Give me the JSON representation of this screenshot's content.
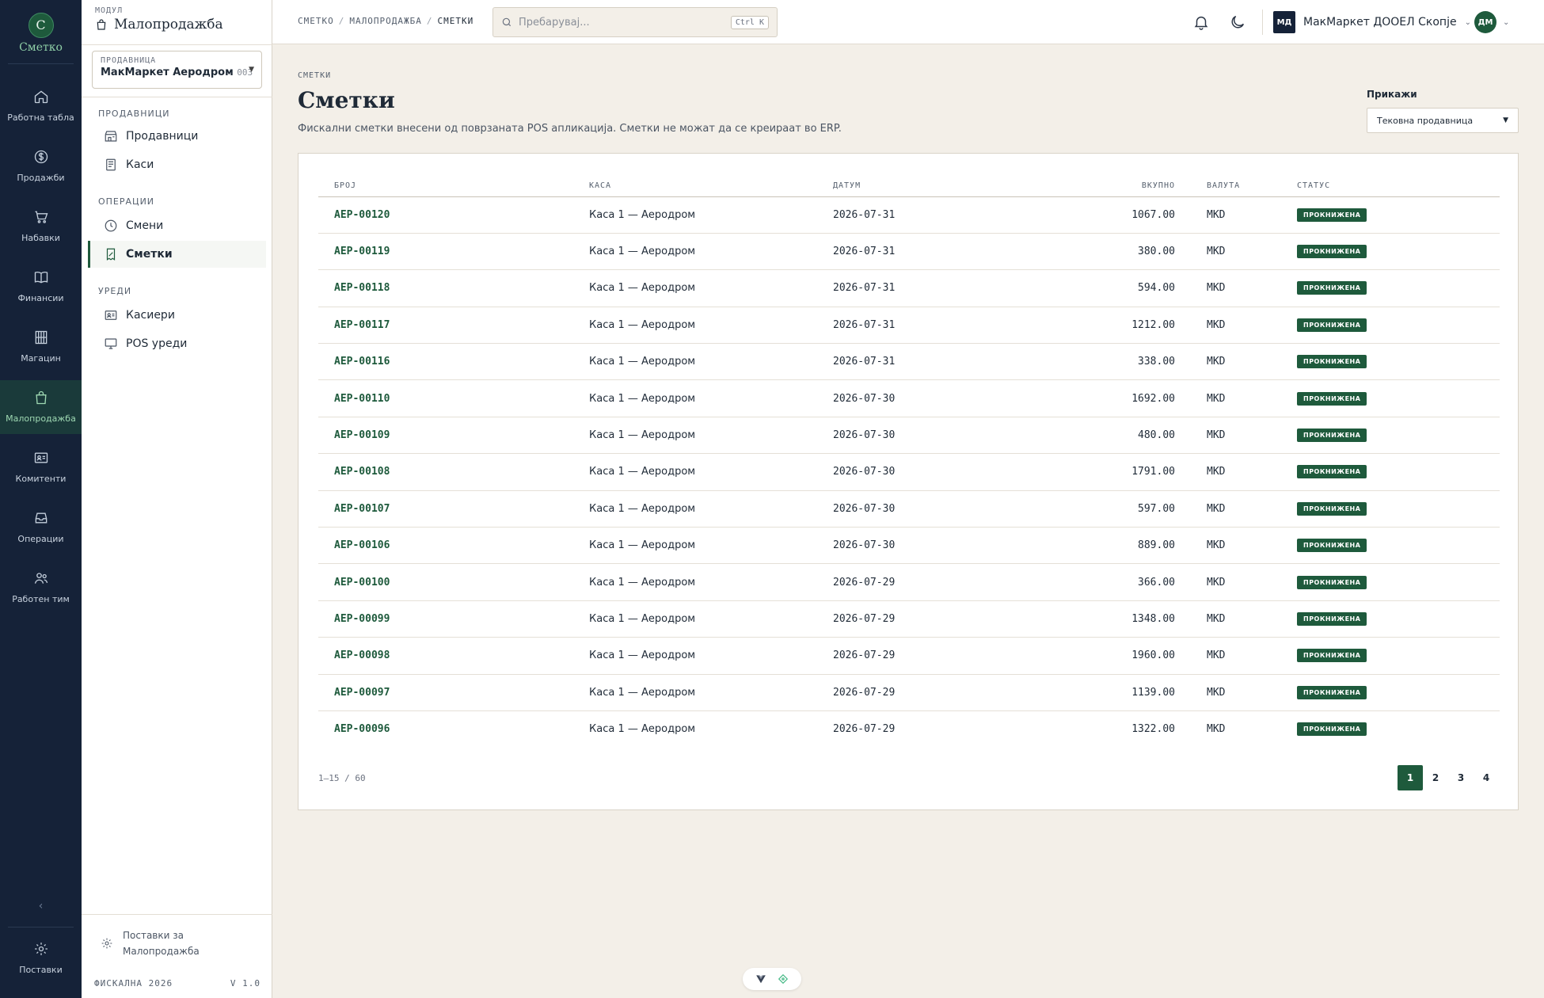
{
  "app": {
    "logo_letter": "С",
    "logo_name": "Сметко"
  },
  "rail": {
    "items": [
      {
        "label": "Работна табла",
        "icon": "home-icon"
      },
      {
        "label": "Продажби",
        "icon": "dollar-icon"
      },
      {
        "label": "Набавки",
        "icon": "cart-icon"
      },
      {
        "label": "Финансии",
        "icon": "book-icon"
      },
      {
        "label": "Магацин",
        "icon": "warehouse-icon"
      },
      {
        "label": "Малопродажба",
        "icon": "shopping-bag-icon",
        "active": true
      },
      {
        "label": "Комитенти",
        "icon": "id-card-icon"
      },
      {
        "label": "Операции",
        "icon": "inbox-icon"
      },
      {
        "label": "Работен тим",
        "icon": "users-icon"
      }
    ],
    "collapse": "‹",
    "settings_label": "Поставки"
  },
  "sidebar": {
    "module_caption": "МОДУЛ",
    "module_title": "Малопродажба",
    "store_caption": "ПРОДАВНИЦА",
    "store_name": "МакМаркет Аеродром",
    "store_code": "003",
    "groups": [
      {
        "label": "ПРОДАВНИЦИ",
        "items": [
          {
            "label": "Продавници",
            "icon": "store-icon"
          },
          {
            "label": "Каси",
            "icon": "register-icon"
          }
        ]
      },
      {
        "label": "ОПЕРАЦИИ",
        "items": [
          {
            "label": "Смени",
            "icon": "clock-icon"
          },
          {
            "label": "Сметки",
            "icon": "receipt-icon",
            "active": true
          }
        ]
      },
      {
        "label": "УРЕДИ",
        "items": [
          {
            "label": "Касиери",
            "icon": "id-card-icon"
          },
          {
            "label": "POS уреди",
            "icon": "monitor-icon"
          }
        ]
      }
    ],
    "settings_line1": "Поставки за",
    "settings_line2": "Малопродажба",
    "footer_left": "ФИСКАЛНА 2026",
    "footer_right": "V 1.0"
  },
  "topbar": {
    "crumbs": [
      "СМЕТКО",
      "МАЛОПРОДАЖБА",
      "СМЕТКИ"
    ],
    "search_placeholder": "Пребарувај...",
    "search_shortcut": "Ctrl K",
    "org_badge": "МД",
    "org_name": "МакМаркет ДООЕЛ Скопје",
    "user_initials": "ДМ"
  },
  "page": {
    "eyebrow": "СМЕТКИ",
    "title": "Сметки",
    "subtitle": "Фискални сметки внесени од поврзаната POS апликација. Сметки не можат да се креираат во ERP.",
    "show_label": "Прикажи",
    "show_value": "Тековна продавница"
  },
  "table": {
    "columns": [
      "БРОЈ",
      "КАСА",
      "ДАТУМ",
      "ВКУПНО",
      "ВАЛУТА",
      "СТАТУС"
    ],
    "rows": [
      [
        "AEP-00120",
        "Каса 1 — Аеродром",
        "2026-07-31",
        "1067.00",
        "MKD",
        "ПРОКНИЖЕНА"
      ],
      [
        "AEP-00119",
        "Каса 1 — Аеродром",
        "2026-07-31",
        "380.00",
        "MKD",
        "ПРОКНИЖЕНА"
      ],
      [
        "AEP-00118",
        "Каса 1 — Аеродром",
        "2026-07-31",
        "594.00",
        "MKD",
        "ПРОКНИЖЕНА"
      ],
      [
        "AEP-00117",
        "Каса 1 — Аеродром",
        "2026-07-31",
        "1212.00",
        "MKD",
        "ПРОКНИЖЕНА"
      ],
      [
        "AEP-00116",
        "Каса 1 — Аеродром",
        "2026-07-31",
        "338.00",
        "MKD",
        "ПРОКНИЖЕНА"
      ],
      [
        "AEP-00110",
        "Каса 1 — Аеродром",
        "2026-07-30",
        "1692.00",
        "MKD",
        "ПРОКНИЖЕНА"
      ],
      [
        "AEP-00109",
        "Каса 1 — Аеродром",
        "2026-07-30",
        "480.00",
        "MKD",
        "ПРОКНИЖЕНА"
      ],
      [
        "AEP-00108",
        "Каса 1 — Аеродром",
        "2026-07-30",
        "1791.00",
        "MKD",
        "ПРОКНИЖЕНА"
      ],
      [
        "AEP-00107",
        "Каса 1 — Аеродром",
        "2026-07-30",
        "597.00",
        "MKD",
        "ПРОКНИЖЕНА"
      ],
      [
        "AEP-00106",
        "Каса 1 — Аеродром",
        "2026-07-30",
        "889.00",
        "MKD",
        "ПРОКНИЖЕНА"
      ],
      [
        "AEP-00100",
        "Каса 1 — Аеродром",
        "2026-07-29",
        "366.00",
        "MKD",
        "ПРОКНИЖЕНА"
      ],
      [
        "AEP-00099",
        "Каса 1 — Аеродром",
        "2026-07-29",
        "1348.00",
        "MKD",
        "ПРОКНИЖЕНА"
      ],
      [
        "AEP-00098",
        "Каса 1 — Аеродром",
        "2026-07-29",
        "1960.00",
        "MKD",
        "ПРОКНИЖЕНА"
      ],
      [
        "AEP-00097",
        "Каса 1 — Аеродром",
        "2026-07-29",
        "1139.00",
        "MKD",
        "ПРОКНИЖЕНА"
      ],
      [
        "AEP-00096",
        "Каса 1 — Аеродром",
        "2026-07-29",
        "1322.00",
        "MKD",
        "ПРОКНИЖЕНА"
      ]
    ],
    "count": "1–15 / 60",
    "pages": [
      "1",
      "2",
      "3",
      "4"
    ],
    "active_page": "1"
  },
  "colors": {
    "accent": "#1e5a3c",
    "rail": "#152238",
    "background": "#f3efe8"
  }
}
